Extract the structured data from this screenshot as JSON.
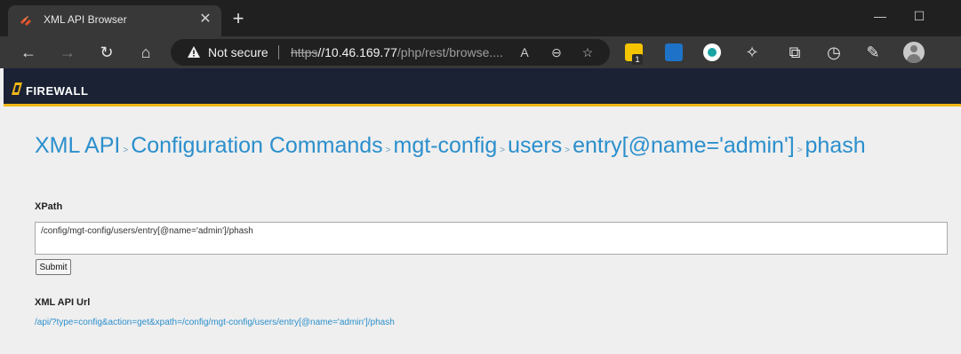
{
  "browser": {
    "tab_title": "XML API Browser",
    "not_secure_label": "Not secure",
    "url_scheme": "https",
    "url_host": "//10.46.169.77",
    "url_path": "/php/rest/browse....",
    "extension_badge": "1",
    "icons": [
      "close-icon",
      "new-tab-icon",
      "minimize-icon",
      "maximize-icon",
      "back-icon",
      "forward-icon",
      "refresh-icon",
      "home-icon",
      "warning-icon",
      "read-aloud-icon",
      "zoom-icon",
      "favorite-add-icon",
      "extension-icon",
      "favorites-icon",
      "history-icon",
      "collections-icon",
      "profile-icon"
    ]
  },
  "header": {
    "brand": "FIREWALL",
    "accent_color": "#f2b715",
    "bg_color": "#1a2234"
  },
  "breadcrumb": [
    "XML API",
    "Configuration Commands",
    "mgt-config",
    "users",
    "entry[@name='admin']",
    "phash"
  ],
  "form": {
    "xpath_label": "XPath",
    "xpath_value": "/config/mgt-config/users/entry[@name='admin']/phash",
    "submit_label": "Submit",
    "api_url_label": "XML API Url",
    "api_url": "/api/?type=config&action=get&xpath=/config/mgt-config/users/entry[@name='admin']/phash"
  },
  "link_color": "#2b8fcc"
}
